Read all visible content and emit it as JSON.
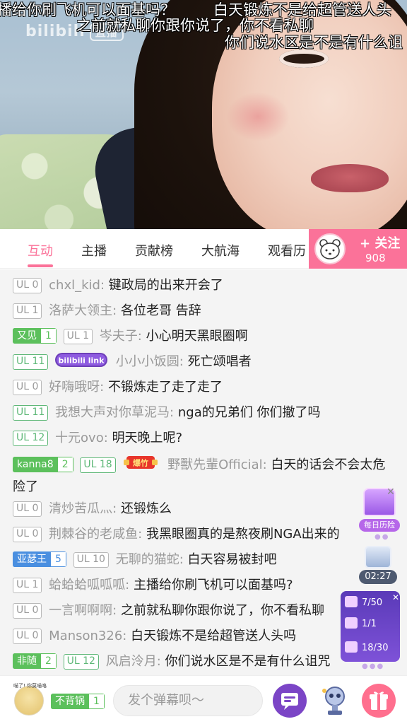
{
  "video": {
    "watermark_text": "bilibili",
    "watermark_badge": "直播",
    "danmaku": [
      "播给你刷飞机可以面基吗？",
      "白天锻炼不是给超管送人头",
      "之前就私聊你跟你说了，你不看私聊",
      "你们说水区是不是有什么诅"
    ]
  },
  "tabs": {
    "items": [
      "互动",
      "主播",
      "贡献榜",
      "大航海",
      "观看历"
    ],
    "active_index": 0
  },
  "follow": {
    "label": "+ 关注",
    "count": "908"
  },
  "chat": {
    "messages": [
      {
        "ul": "UL 0",
        "name": "chxl_kid:",
        "text": "键政局的出来开会了"
      },
      {
        "ul": "UL 1",
        "name": "洛萨大领主:",
        "text": "各位老哥 告辞"
      },
      {
        "medal_name": "又见",
        "medal_level": "1",
        "ul": "UL 1",
        "name": "岑夫子:",
        "text": "小心明天黑眼圈啊"
      },
      {
        "ul": "UL 11",
        "title_badge": "bilibili link",
        "name": "小小小饭圆:",
        "text": "死亡颂唱者"
      },
      {
        "ul": "UL 0",
        "name": "好嗨哦呀:",
        "text": "不锻炼走了走了走了"
      },
      {
        "ul": "UL 11",
        "name": "我想大声对你草泥马:",
        "text": "nga的兄弟们 你们撤了吗"
      },
      {
        "ul": "UL 12",
        "name": "十元ovo:",
        "text": "明天晚上呢?"
      },
      {
        "medal_name": "kanna8",
        "medal_level": "2",
        "ul": "UL 18",
        "title_badge": "爆竹",
        "name": "野獸先輩Official:",
        "text": "白天的话会不会太危险了"
      },
      {
        "ul": "UL 0",
        "name": "清炒苦瓜灬:",
        "text": "还锻炼么"
      },
      {
        "ul": "UL 0",
        "name": "荆棘谷的老咸鱼:",
        "text": "我黑眼圈真的是熬夜刷NGA出来的"
      },
      {
        "medal_name": "亚瑟王",
        "medal_level": "5",
        "ul": "UL 10",
        "name": "无聊的猫蛇:",
        "text": "白天容易被封吧"
      },
      {
        "ul": "UL 1",
        "name": "蛤蛤蛤呱呱呱:",
        "text": "主播给你刷飞机可以面基吗?"
      },
      {
        "ul": "UL 0",
        "name": "一言啊啊啊:",
        "text": "之前就私聊你跟你说了，你不看私聊"
      },
      {
        "ul": "UL 0",
        "name": "Manson326:",
        "text": "白天锻炼不是给超管送人头吗"
      },
      {
        "medal_name": "非随",
        "medal_level": "2",
        "ul": "UL 12",
        "name": "风启泠月:",
        "text": "你们说水区是不是有什么诅咒"
      }
    ]
  },
  "side": {
    "history_label": "每日历险",
    "timer": "02:27",
    "tasks": [
      {
        "value": "7/50"
      },
      {
        "value": "1/1"
      },
      {
        "value": "18/30"
      }
    ]
  },
  "bottom": {
    "avatar_caption": "喵了! 你莫喵咯",
    "my_medal_name": "不背锅",
    "my_medal_level": "1",
    "input_placeholder": "发个弹幕呗～"
  },
  "colors": {
    "accent": "#fb7299",
    "medal_green": "#5cc05c",
    "medal_blue": "#4a8fe0",
    "chat_bg": "#f4f4f4"
  }
}
